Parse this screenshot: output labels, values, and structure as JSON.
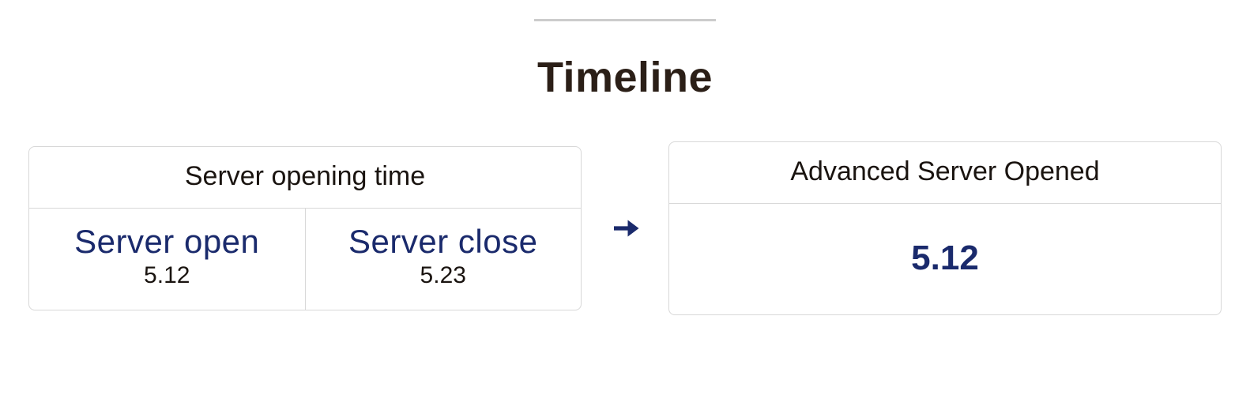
{
  "title": "Timeline",
  "left_box": {
    "header": "Server opening time",
    "cells": [
      {
        "label": "Server open",
        "date": "5.12"
      },
      {
        "label": "Server close",
        "date": "5.23"
      }
    ]
  },
  "right_box": {
    "header": "Advanced Server Opened",
    "value": "5.12"
  }
}
